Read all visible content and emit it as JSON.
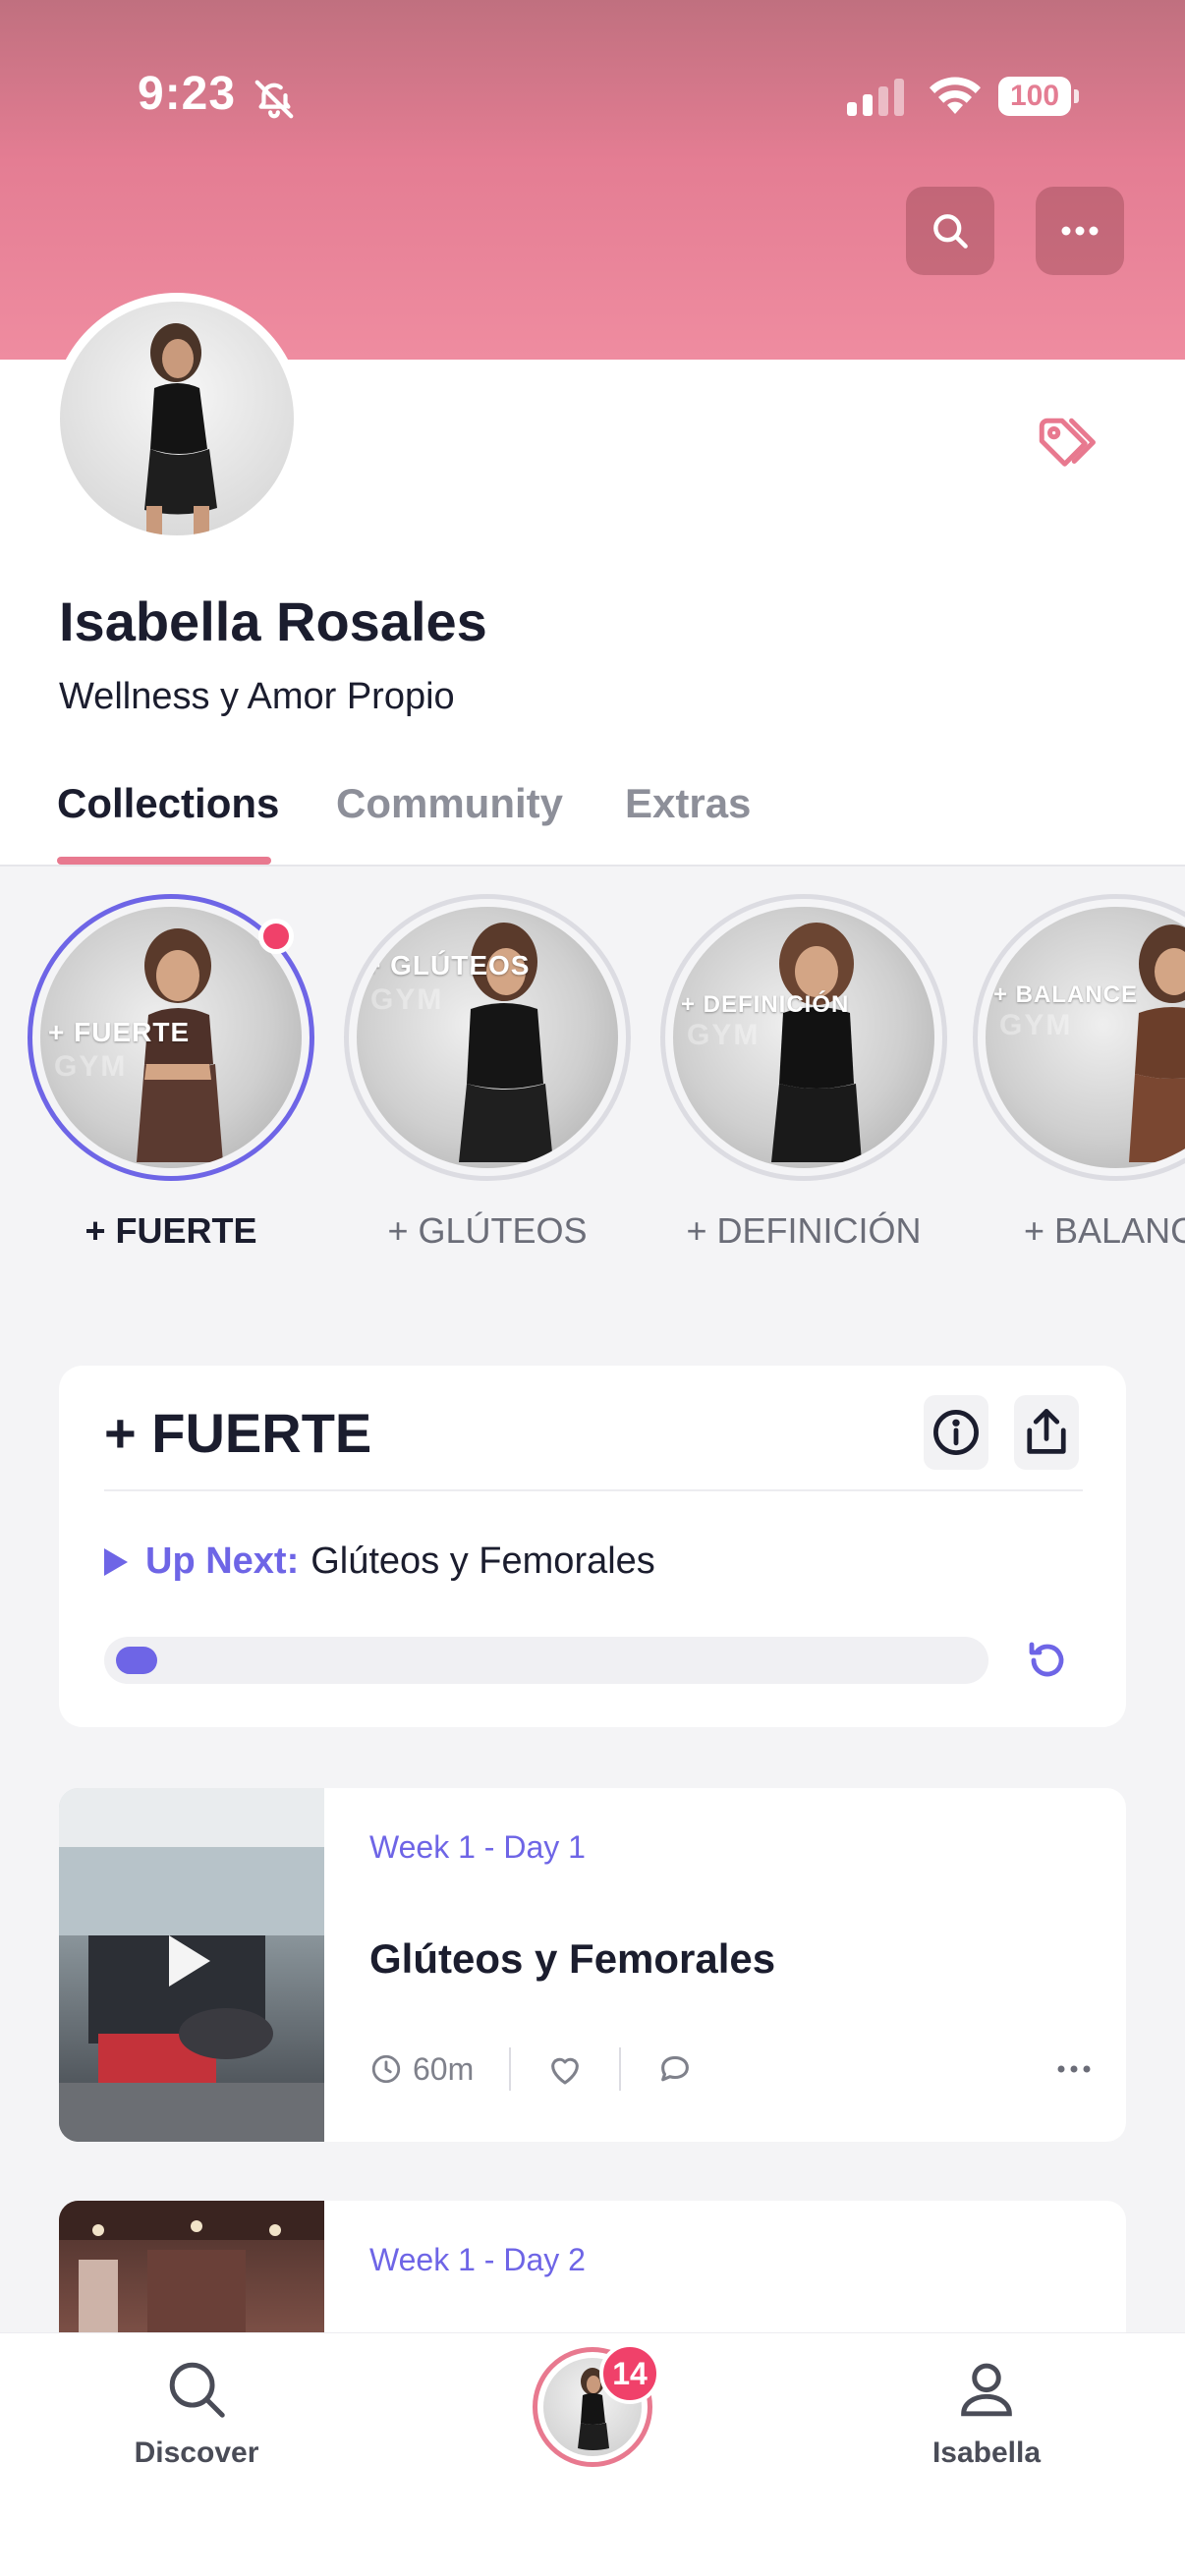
{
  "status_bar": {
    "time": "9:23",
    "battery": "100"
  },
  "profile": {
    "name": "Isabella Rosales",
    "subtitle": "Wellness y Amor Propio"
  },
  "tabs": [
    {
      "label": "Collections",
      "active": true
    },
    {
      "label": "Community",
      "active": false
    },
    {
      "label": "Extras",
      "active": false
    }
  ],
  "stories": [
    {
      "label": "+ FUERTE",
      "overlay": "+ FUERTE",
      "gym": "GYM",
      "active": true,
      "new": true
    },
    {
      "label": "+ GLÚTEOS",
      "overlay": "+ GLÚTEOS",
      "gym": "GYM",
      "active": false,
      "new": false
    },
    {
      "label": "+ DEFINICIÓN",
      "overlay": "+ DEFINICIÓN",
      "gym": "GYM",
      "active": false,
      "new": false
    },
    {
      "label": "+ BALANCE",
      "overlay": "+ BALANCE",
      "gym": "GYM",
      "active": false,
      "new": false
    }
  ],
  "collection": {
    "title": "+ FUERTE",
    "up_next_label": "Up Next:",
    "up_next_title": "Glúteos y Femorales",
    "progress_fraction": 0.02,
    "accent": "#6e65e6"
  },
  "workouts": [
    {
      "week_day": "Week 1 - Day 1",
      "title": "Glúteos y Femorales",
      "duration": "60m"
    },
    {
      "week_day": "Week 1 - Day 2",
      "title": "",
      "duration": ""
    }
  ],
  "bottom_nav": {
    "discover": "Discover",
    "me": "Isabella",
    "badge": "14"
  },
  "colors": {
    "header_pink": "#e47d93",
    "accent_purple": "#6e65e6",
    "badge_red": "#f0416a"
  }
}
